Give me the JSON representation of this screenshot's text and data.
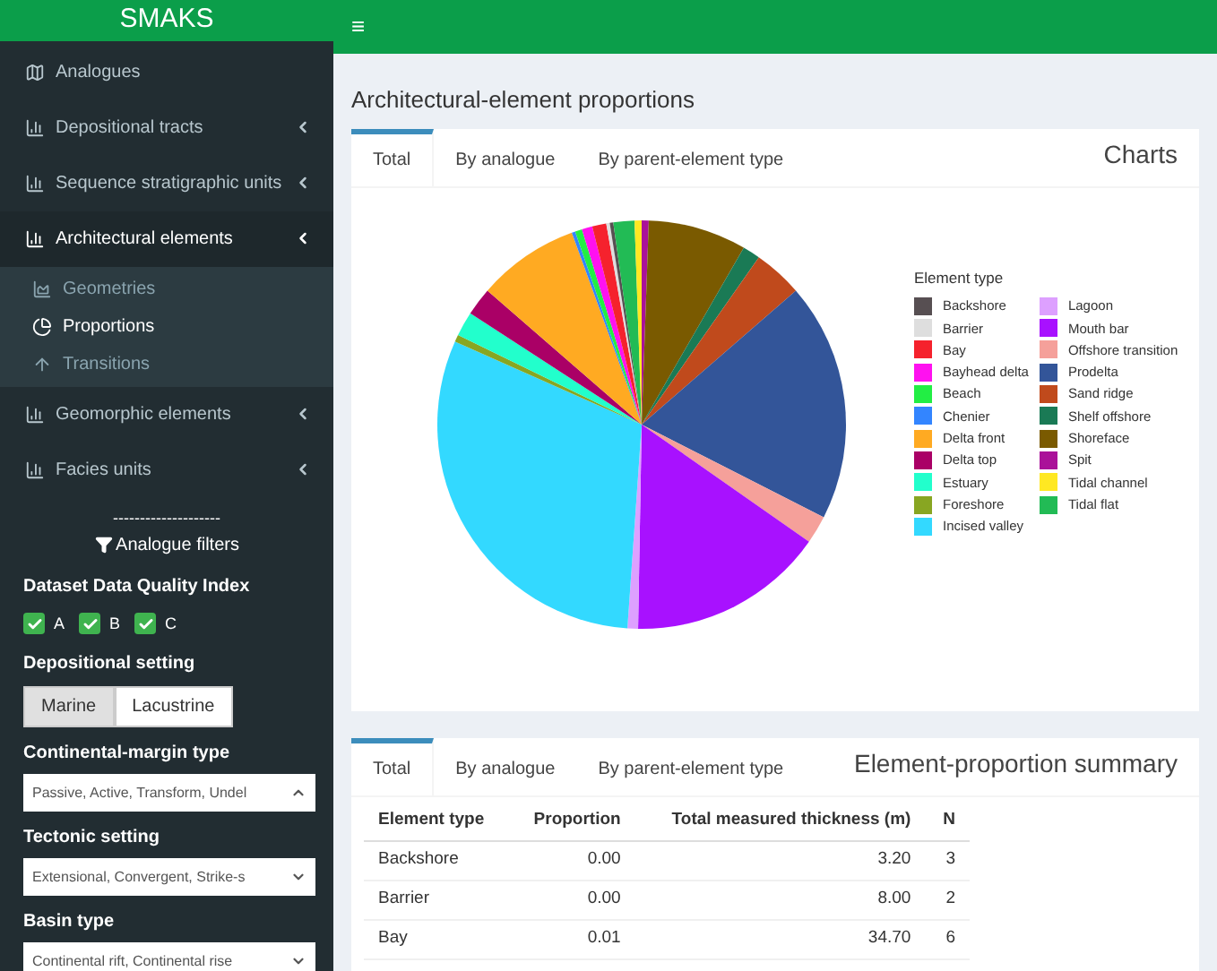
{
  "header": {
    "logo": "SMAKS",
    "menu_toggle": "≡"
  },
  "sidebar": {
    "items": [
      {
        "label": "Analogues",
        "has_children": false,
        "expanded": false
      },
      {
        "label": "Depositional tracts",
        "has_children": true,
        "expanded": false
      },
      {
        "label": "Sequence stratigraphic units",
        "has_children": true,
        "expanded": false
      },
      {
        "label": "Architectural elements",
        "has_children": true,
        "expanded": true,
        "children": [
          {
            "label": "Geometries",
            "selected": false
          },
          {
            "label": "Proportions",
            "selected": true
          },
          {
            "label": "Transitions",
            "selected": false
          }
        ]
      },
      {
        "label": "Geomorphic elements",
        "has_children": true,
        "expanded": false
      },
      {
        "label": "Facies units",
        "has_children": true,
        "expanded": false
      }
    ],
    "separator": "--------------------",
    "filters_title": "Analogue filters",
    "quality_label": "Dataset Data Quality Index",
    "quality": [
      {
        "label": "A",
        "checked": true
      },
      {
        "label": "B",
        "checked": true
      },
      {
        "label": "C",
        "checked": true
      }
    ],
    "setting_label": "Depositional setting",
    "settings": [
      {
        "label": "Marine",
        "selected": true
      },
      {
        "label": "Lacustrine",
        "selected": false
      }
    ],
    "selects": [
      {
        "label": "Continental-margin type",
        "value": "Passive, Active, Transform, Undel",
        "expanded": true
      },
      {
        "label": "Tectonic setting",
        "value": "Extensional, Convergent, Strike-s",
        "expanded": false
      },
      {
        "label": "Basin type",
        "value": "Continental rift, Continental rise",
        "expanded": false
      }
    ]
  },
  "page_title": "Architectural-element proportions",
  "charts_box": {
    "title": "Charts",
    "tabs": [
      {
        "label": "Total",
        "selected": true
      },
      {
        "label": "By analogue",
        "selected": false
      },
      {
        "label": "By parent-element type",
        "selected": false
      }
    ],
    "legend_title": "Element type",
    "legend": [
      {
        "label": "Backshore",
        "color": "#574f52"
      },
      {
        "label": "Barrier",
        "color": "#dedede"
      },
      {
        "label": "Bay",
        "color": "#f5222d"
      },
      {
        "label": "Bayhead delta",
        "color": "#ff11f0"
      },
      {
        "label": "Beach",
        "color": "#22ee44"
      },
      {
        "label": "Chenier",
        "color": "#3385ff"
      },
      {
        "label": "Delta front",
        "color": "#ffaa22"
      },
      {
        "label": "Delta top",
        "color": "#aa0066"
      },
      {
        "label": "Estuary",
        "color": "#22ffcc"
      },
      {
        "label": "Foreshore",
        "color": "#88a622"
      },
      {
        "label": "Incised valley",
        "color": "#33d9ff"
      },
      {
        "label": "Lagoon",
        "color": "#dda0ff"
      },
      {
        "label": "Mouth bar",
        "color": "#a811ff"
      },
      {
        "label": "Offshore transition",
        "color": "#f5a09a"
      },
      {
        "label": "Prodelta",
        "color": "#335599"
      },
      {
        "label": "Sand ridge",
        "color": "#c04a1c"
      },
      {
        "label": "Shelf offshore",
        "color": "#1a7a55"
      },
      {
        "label": "Shoreface",
        "color": "#7a5a00"
      },
      {
        "label": "Spit",
        "color": "#aa1199"
      },
      {
        "label": "Tidal channel",
        "color": "#ffe822"
      },
      {
        "label": "Tidal flat",
        "color": "#22bb55"
      }
    ]
  },
  "summary_box": {
    "title": "Element-proportion summary",
    "tabs": [
      {
        "label": "Total",
        "selected": true
      },
      {
        "label": "By analogue",
        "selected": false
      },
      {
        "label": "By parent-element type",
        "selected": false
      }
    ],
    "columns": [
      "Element type",
      "Proportion",
      "Total measured thickness (m)",
      "N"
    ],
    "rows": [
      [
        "Backshore",
        "0.00",
        "3.20",
        "3"
      ],
      [
        "Barrier",
        "0.00",
        "8.00",
        "2"
      ],
      [
        "Bay",
        "0.01",
        "34.70",
        "6"
      ]
    ]
  }
}
